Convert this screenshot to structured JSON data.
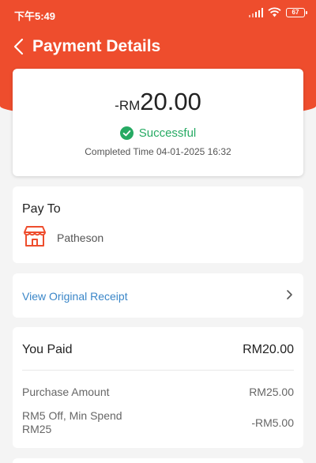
{
  "status_bar": {
    "time": "下午5:49",
    "battery": "67"
  },
  "header": {
    "title": "Payment Details",
    "back_icon": "chevron-left-icon"
  },
  "summary": {
    "amount_prefix": "-RM",
    "amount_value": "20.00",
    "status": "Successful",
    "status_icon": "check-circle-icon",
    "completed_time": "Completed Time 04-01-2025 16:32"
  },
  "pay_to": {
    "label": "Pay To",
    "merchant_icon": "shop-icon",
    "merchant": "Patheson"
  },
  "receipt": {
    "link_label": "View Original Receipt"
  },
  "you_paid": {
    "label": "You Paid",
    "value": "RM20.00",
    "rows": [
      {
        "label": "Purchase Amount",
        "value": "RM25.00"
      },
      {
        "label": "RM5 Off, Min Spend RM25",
        "value": "-RM5.00"
      }
    ]
  },
  "colors": {
    "brand": "#ee4d2d",
    "success": "#26aa63",
    "link": "#3a86c8"
  }
}
